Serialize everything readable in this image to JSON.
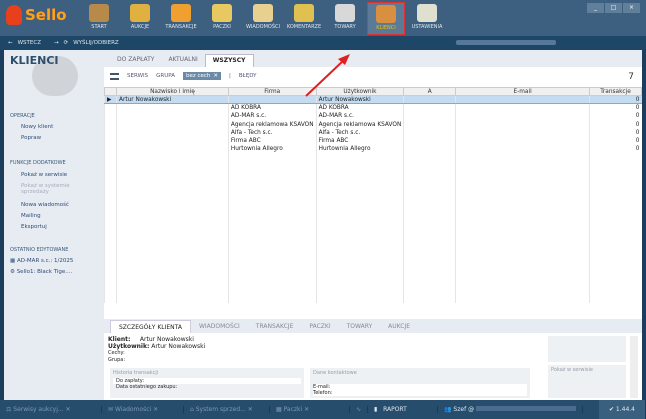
{
  "app": {
    "logo": "Sello"
  },
  "nav": [
    {
      "label": "START"
    },
    {
      "label": "AUKCJE"
    },
    {
      "label": "TRANSAKCJE"
    },
    {
      "label": "PACZKI"
    },
    {
      "label": "WIADOMOŚCI"
    },
    {
      "label": "KOMENTARZE"
    },
    {
      "label": "TOWARY"
    },
    {
      "label": "KLIENCI",
      "active": true
    },
    {
      "label": "USTAWIENIA"
    }
  ],
  "nav_colors": [
    "#b88a4a",
    "#e0b040",
    "#f0a030",
    "#e8c860",
    "#e8d090",
    "#e0c050",
    "#d8d8d8",
    "#d89040",
    "#e0e0d0"
  ],
  "window": {
    "minimize": "_",
    "maximize": "□",
    "close": "×"
  },
  "subnav": {
    "back": "WSTECZ",
    "send": "WYŚLIJ/ODBIERZ"
  },
  "sidebar": {
    "title": "KLIENCI",
    "operations_header": "OPERACJE",
    "operations": [
      "Nowy klient",
      "Popraw"
    ],
    "extra_header": "FUNKCJE DODATKOWE",
    "extra": [
      "Pokaż w serwisie",
      "Pokaż w systemie sprzedaży",
      "Nowa wiadomość",
      "Mailing",
      "Eksportuj"
    ],
    "recent_header": "OSTATNIO EDYTOWANE",
    "recent": [
      "AD-MAR s.c.: 1/2025",
      "Sello1: Black Tige...."
    ]
  },
  "tabs": [
    "DO ZAPŁATY",
    "AKTUALNI",
    "WSZYSCY"
  ],
  "toolbar": {
    "serwis": "SERWIS",
    "grupa": "GRUPA",
    "filter": "bez cech",
    "filter_clear": "✕",
    "sep": "|",
    "errors": "BŁĘDY",
    "count": "7"
  },
  "table": {
    "columns": [
      "Nazwisko i imię",
      "Firma",
      "Użytkownik",
      "A",
      "E-mail",
      "Transakcje"
    ],
    "rows": [
      [
        "Artur Nowakowski",
        "",
        "Artur Nowakowski",
        "",
        "",
        "0"
      ],
      [
        "",
        "AD KOBRA",
        "AD KOBRA",
        "",
        "",
        "0"
      ],
      [
        "",
        "AD-MAR s.c.",
        "AD-MAR s.c.",
        "",
        "",
        "0"
      ],
      [
        "",
        "Agencja reklamowa KSAVON",
        "Agencja reklamowa KSAVON",
        "",
        "",
        "0"
      ],
      [
        "",
        "Alfa - Tech s.c.",
        "Alfa - Tech s.c.",
        "",
        "",
        "0"
      ],
      [
        "",
        "Firma ABC",
        "Firma ABC",
        "",
        "",
        "0"
      ],
      [
        "",
        "Hurtownia Allegro",
        "Hurtownia Allegro",
        "",
        "",
        "0"
      ]
    ]
  },
  "detail_tabs": [
    "SZCZEGÓŁY KLIENTA",
    "WIADOMOŚCI",
    "TRANSAKCJE",
    "PACZKI",
    "TOWARY",
    "AUKCJE"
  ],
  "detail": {
    "client_label": "Klient:",
    "client": "Artur Nowakowski",
    "user_label": "Użytkownik:",
    "user": "Artur Nowakowski",
    "traits_label": "Cechy:",
    "group_label": "Grupa:",
    "history": "Historia transakcji",
    "to_pay": "Do zapłaty:",
    "last_purchase": "Data ostatniego zakupu:",
    "contact": "Dane kontaktowe",
    "email": "E-mail:",
    "phone": "Telefon:",
    "show_service": "Pokaż w serwisie"
  },
  "taskbar": {
    "items": [
      "Serwisy aukcyj...",
      "Wiadomości",
      "System sprzed...",
      "Paczki"
    ],
    "report": "RAPORT",
    "user": "Szef @",
    "version": "1.44.4"
  }
}
